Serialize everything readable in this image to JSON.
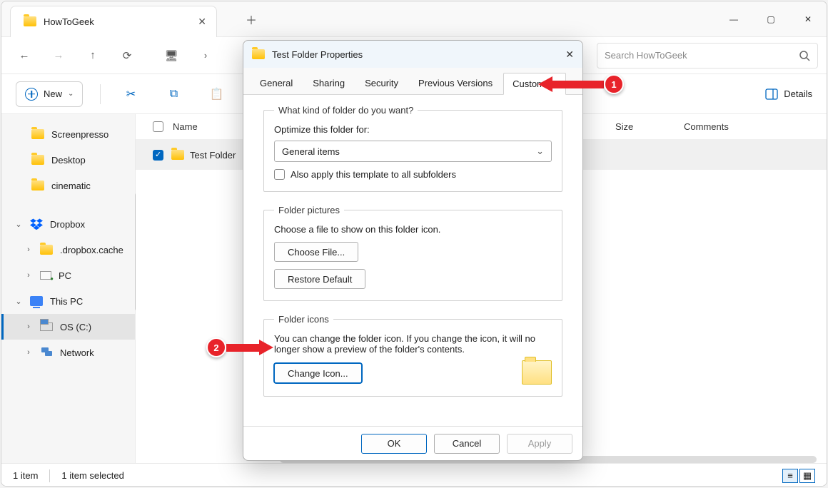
{
  "window": {
    "tab_title": "HowToGeek",
    "search_placeholder": "Search HowToGeek"
  },
  "actionbar": {
    "new_label": "New",
    "details_label": "Details"
  },
  "sidebar": {
    "items": [
      {
        "label": "Screenpresso"
      },
      {
        "label": "Desktop"
      },
      {
        "label": "cinematic"
      }
    ],
    "dropbox": {
      "label": "Dropbox"
    },
    "dropbox_cache": {
      "label": ".dropbox.cache"
    },
    "pc_item": {
      "label": "PC"
    },
    "thispc": {
      "label": "This PC"
    },
    "os_c": {
      "label": "OS (C:)"
    },
    "network": {
      "label": "Network"
    }
  },
  "columns": {
    "name": "Name",
    "size": "Size",
    "comments": "Comments"
  },
  "rows": [
    {
      "name": "Test Folder"
    }
  ],
  "statusbar": {
    "count": "1 item",
    "selected": "1 item selected"
  },
  "dialog": {
    "title": "Test Folder Properties",
    "tabs": [
      "General",
      "Sharing",
      "Security",
      "Previous Versions",
      "Customize"
    ],
    "group1": {
      "legend": "What kind of folder do you want?",
      "label": "Optimize this folder for:",
      "select_value": "General items",
      "checkbox_label": "Also apply this template to all subfolders"
    },
    "group2": {
      "legend": "Folder pictures",
      "label": "Choose a file to show on this folder icon.",
      "choose_btn": "Choose File...",
      "restore_btn": "Restore Default"
    },
    "group3": {
      "legend": "Folder icons",
      "label": "You can change the folder icon. If you change the icon, it will no longer show a preview of the folder's contents.",
      "change_btn": "Change Icon..."
    },
    "footer": {
      "ok": "OK",
      "cancel": "Cancel",
      "apply": "Apply"
    }
  },
  "callouts": {
    "one": "1",
    "two": "2"
  }
}
